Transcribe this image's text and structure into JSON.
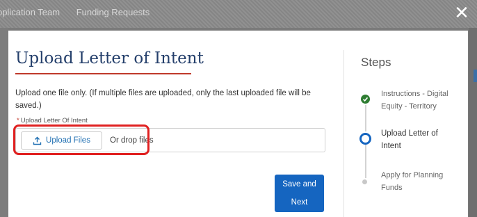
{
  "topnav": {
    "items": [
      "pplication Team",
      "Funding Requests"
    ]
  },
  "modal": {
    "title": "Upload Letter of Intent",
    "description": "Upload one file only.  (If multiple files are uploaded, only the last uploaded file will be saved.)",
    "field_label": "Upload Letter Of Intent",
    "required_marker": "*",
    "upload_button_label": "Upload Files",
    "drop_text": "Or drop files",
    "save_button_line1": "Save and",
    "save_button_line2": "Next"
  },
  "steps": {
    "title": "Steps",
    "items": [
      {
        "label": "Instructions - Digital Equity - Territory",
        "status": "complete"
      },
      {
        "label": "Upload Letter of Intent",
        "status": "current"
      },
      {
        "label": "Apply for Planning Funds",
        "status": "upcoming"
      }
    ]
  },
  "icons": {
    "close": "close-icon",
    "upload": "upload-icon",
    "check": "check-icon"
  },
  "colors": {
    "title": "#243f6b",
    "underline": "#c0392b",
    "primary": "#1565c0",
    "link": "#1f6fb2",
    "complete": "#2e7d32",
    "highlight": "#e02020"
  }
}
